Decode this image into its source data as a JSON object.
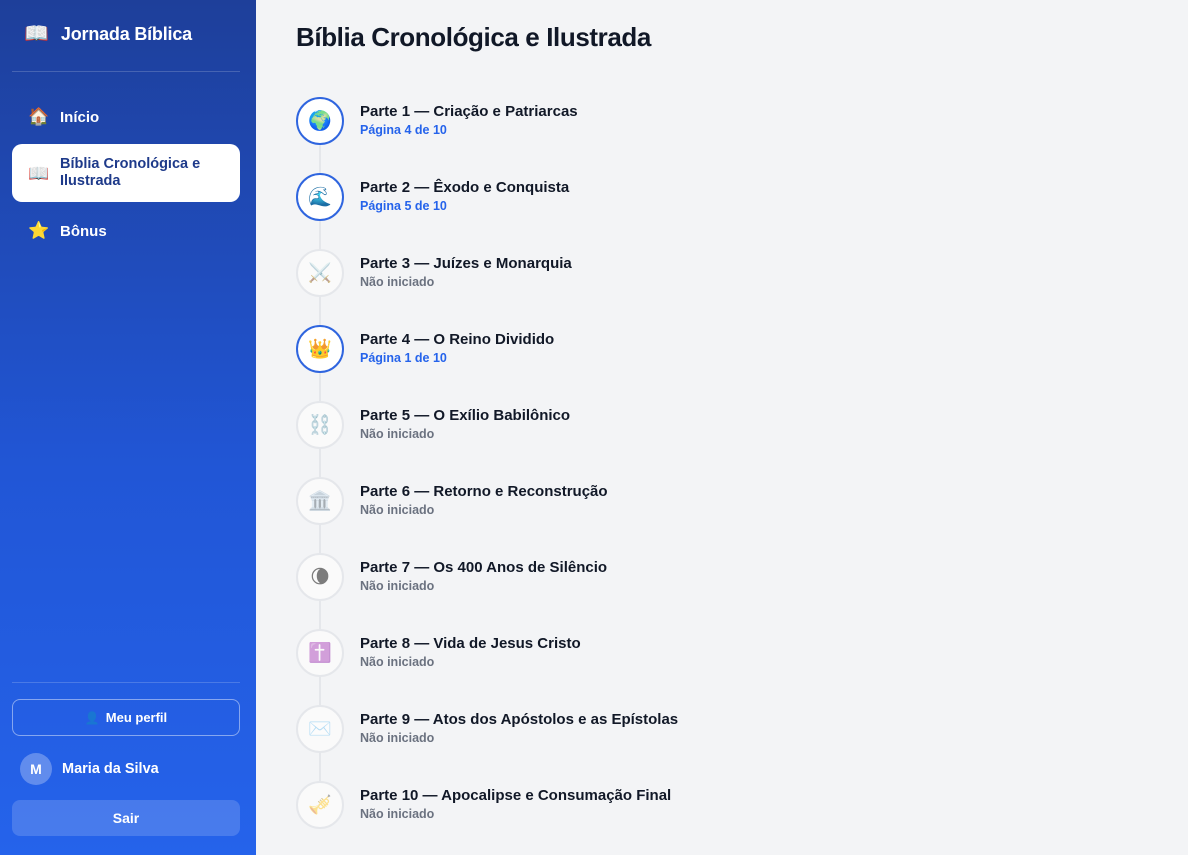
{
  "app": {
    "name": "Jornada Bíblica",
    "logo_icon": "open-book-icon"
  },
  "nav": [
    {
      "label": "Início",
      "icon": "house-icon",
      "glyph": "🏠"
    },
    {
      "label": "Bíblia Cronológica e Ilustrada",
      "icon": "open-book-icon",
      "glyph": "📖",
      "active": true
    },
    {
      "label": "Bônus",
      "icon": "star-icon",
      "glyph": "⭐"
    }
  ],
  "footer": {
    "profile_label": "Meu perfil",
    "profile_icon": "user-icon",
    "user_initial": "M",
    "user_name": "Maria da Silva",
    "logout_label": "Sair"
  },
  "page": {
    "title": "Bíblia Cronológica e Ilustrada"
  },
  "parts": [
    {
      "title": "Parte 1 — Criação e Patriarcas",
      "status": "Página 4 de 10",
      "started": true,
      "icon": "globe-icon",
      "glyph": "🌍"
    },
    {
      "title": "Parte 2 — Êxodo e Conquista",
      "status": "Página 5 de 10",
      "started": true,
      "icon": "wave-icon",
      "glyph": "🌊"
    },
    {
      "title": "Parte 3 — Juízes e Monarquia",
      "status": "Não iniciado",
      "started": false,
      "icon": "crossed-swords-icon",
      "glyph": "⚔️"
    },
    {
      "title": "Parte 4 — O Reino Dividido",
      "status": "Página 1 de 10",
      "started": true,
      "icon": "crown-icon",
      "glyph": "👑"
    },
    {
      "title": "Parte 5 — O Exílio Babilônico",
      "status": "Não iniciado",
      "started": false,
      "icon": "chains-icon",
      "glyph": "⛓️"
    },
    {
      "title": "Parte 6 — Retorno e Reconstrução",
      "status": "Não iniciado",
      "started": false,
      "icon": "temple-icon",
      "glyph": "🏛️"
    },
    {
      "title": "Parte 7 — Os 400 Anos de Silêncio",
      "status": "Não iniciado",
      "started": false,
      "icon": "moon-icon",
      "glyph": "🌘"
    },
    {
      "title": "Parte 8 — Vida de Jesus Cristo",
      "status": "Não iniciado",
      "started": false,
      "icon": "cross-icon",
      "glyph": "✝️"
    },
    {
      "title": "Parte 9 — Atos dos Apóstolos e as Epístolas",
      "status": "Não iniciado",
      "started": false,
      "icon": "envelope-icon",
      "glyph": "✉️"
    },
    {
      "title": "Parte 10 — Apocalipse e Consumação Final",
      "status": "Não iniciado",
      "started": false,
      "icon": "trumpet-icon",
      "glyph": "🎺"
    }
  ]
}
